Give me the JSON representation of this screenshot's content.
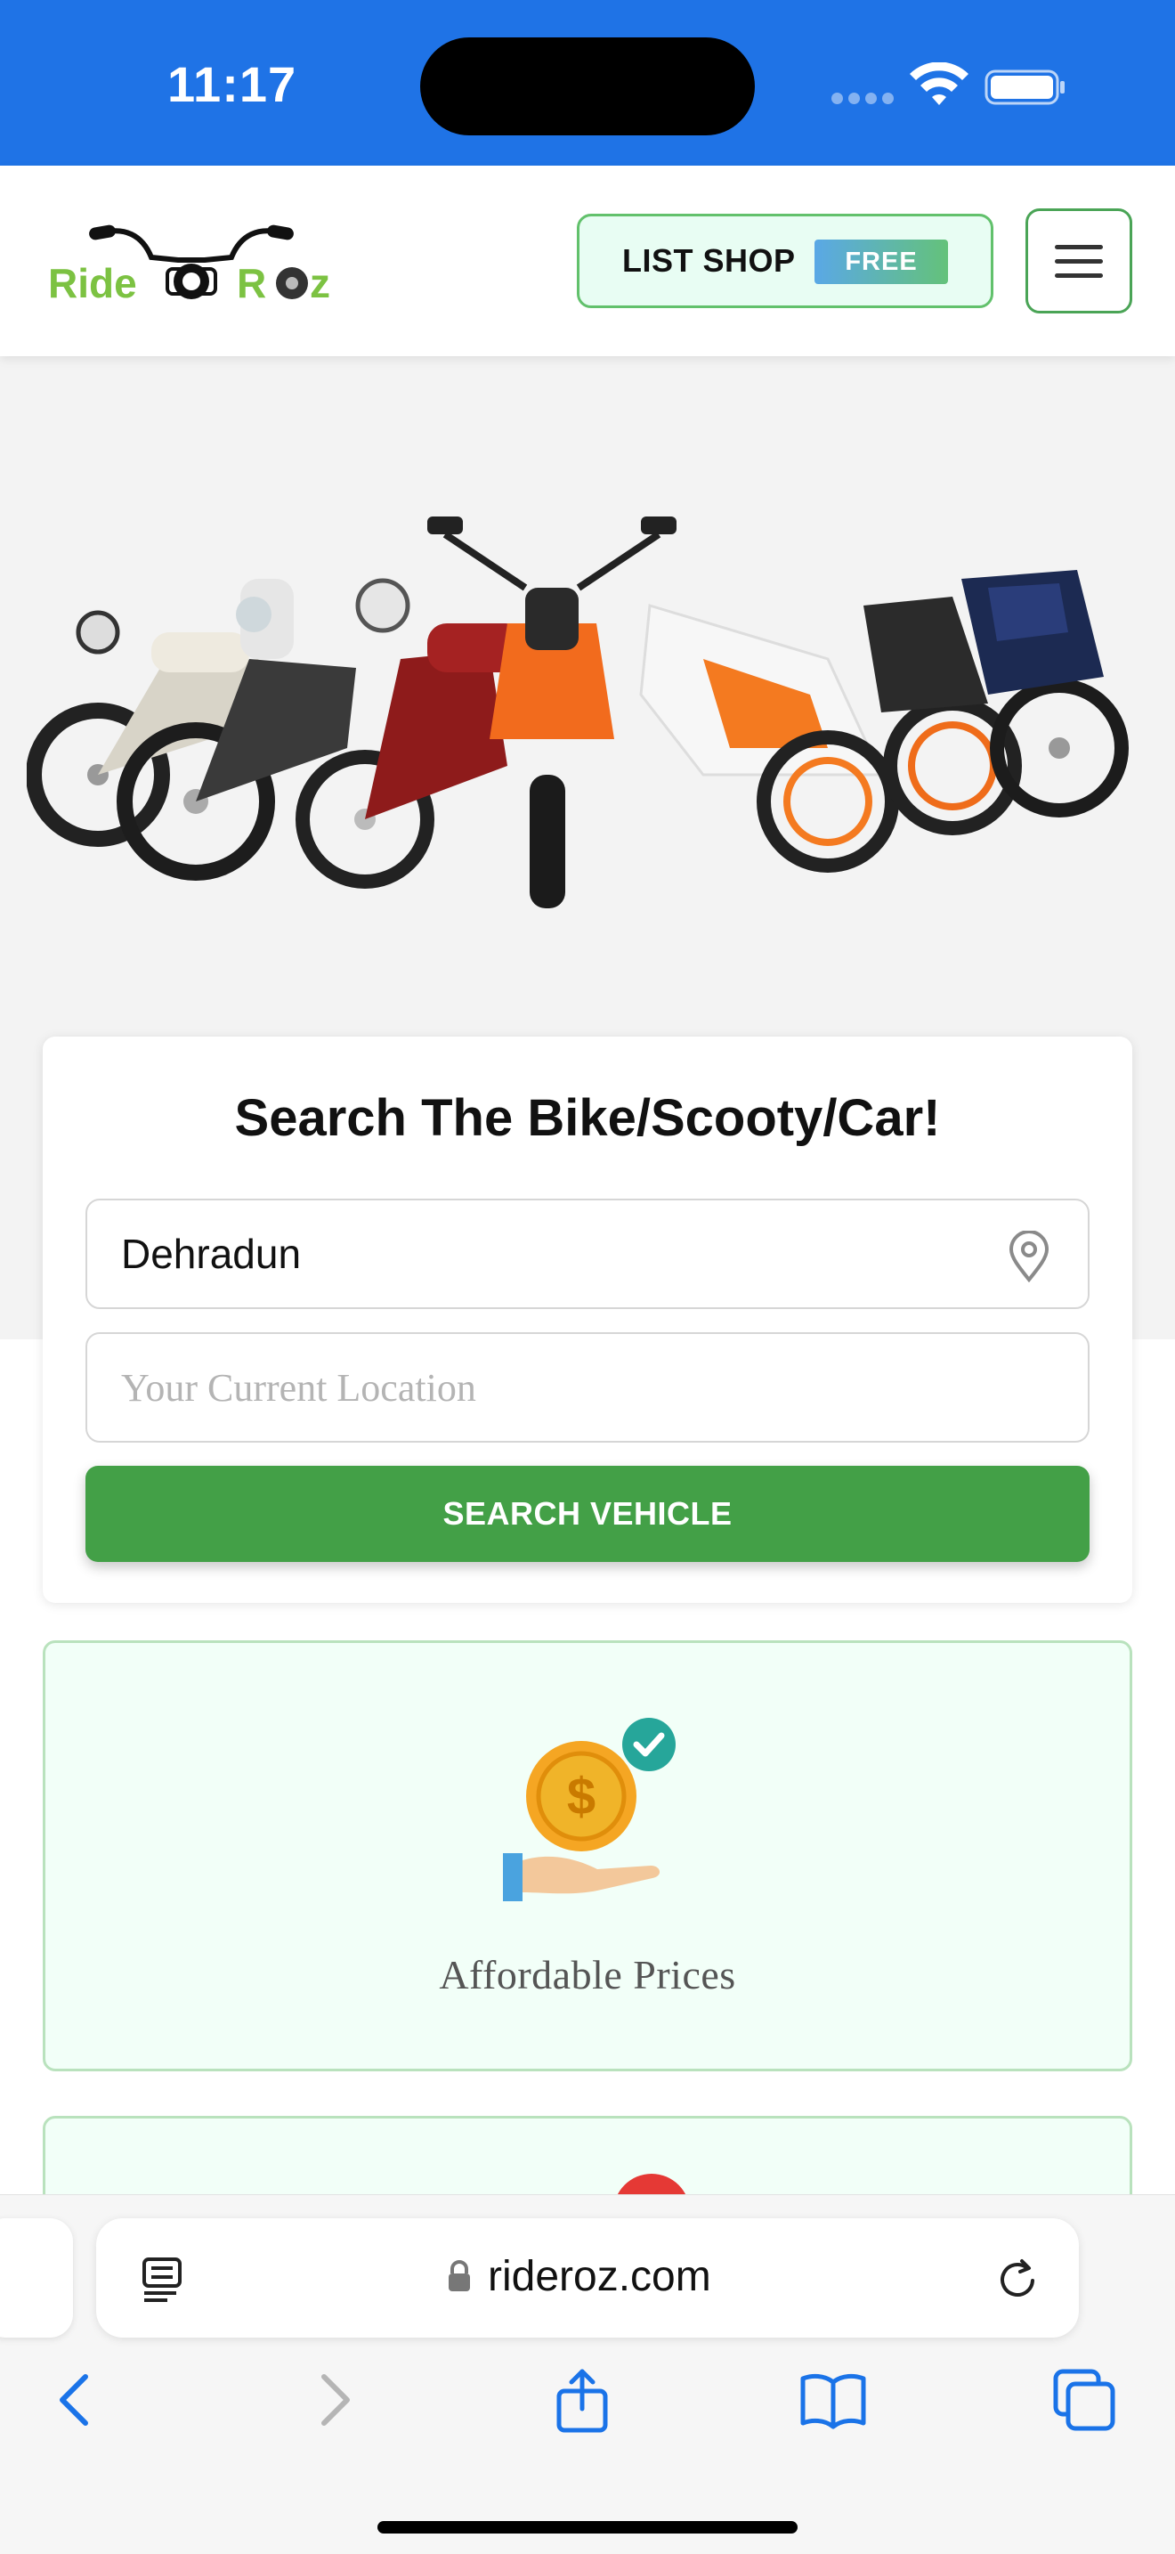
{
  "status_bar": {
    "time": "11:17",
    "icons": [
      "cellular-signal-icon",
      "wifi-icon",
      "battery-icon"
    ]
  },
  "header": {
    "logo": {
      "text_left": "Ride",
      "text_right": "Roz",
      "icon": "handlebar-logo-icon"
    },
    "list_shop_label": "LIST SHOP",
    "free_badge": "FREE",
    "menu_icon": "hamburger-menu-icon"
  },
  "hero": {
    "image": "motorcycles-lineup-image"
  },
  "search": {
    "title": "Search The Bike/Scooty/Car!",
    "city_value": "Dehradun",
    "location_placeholder": "Your Current Location",
    "button_label": "SEARCH VEHICLE"
  },
  "features": [
    {
      "icon": "coin-in-hand-icon",
      "label": "Affordable Prices"
    }
  ],
  "browser": {
    "url": "rideroz.com",
    "icons": [
      "reader-icon",
      "lock-icon",
      "reload-icon",
      "back-icon",
      "forward-icon",
      "share-icon",
      "bookmarks-icon",
      "tabs-icon"
    ]
  },
  "colors": {
    "status_bar": "#1f73e6",
    "brand_green": "#43a047",
    "logo_green": "#7cc242",
    "feature_bg": "#f2fff8",
    "ios_blue": "#1a73e8"
  }
}
